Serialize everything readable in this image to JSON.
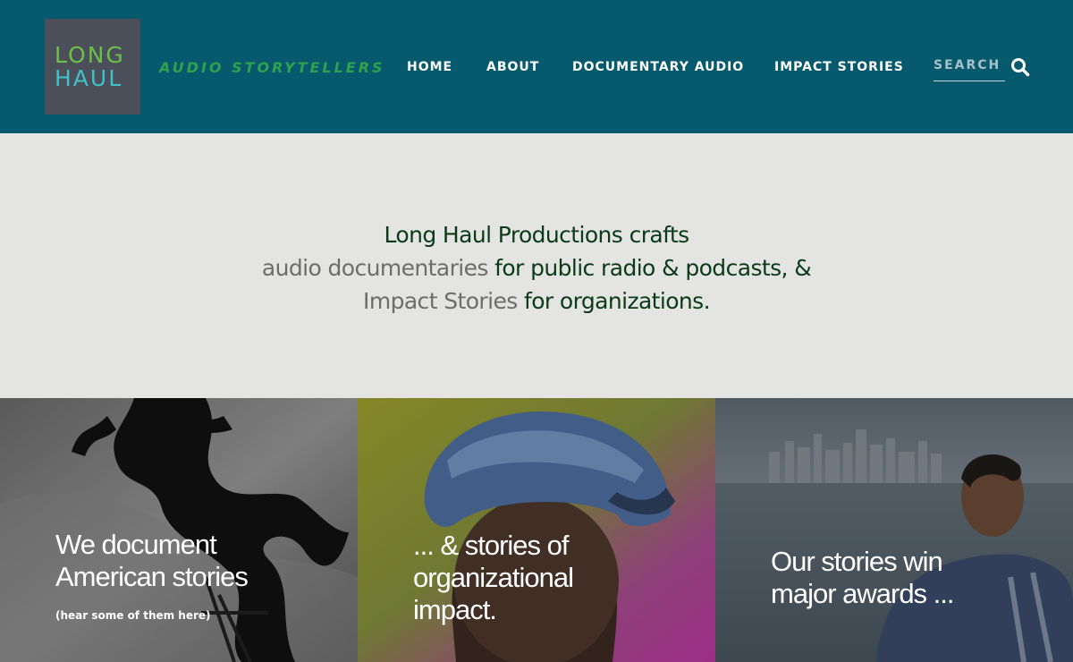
{
  "logo": {
    "line1": "LONG",
    "line2": "HAUL"
  },
  "header": {
    "tagline": "AUDIO STORYTELLERS"
  },
  "nav": {
    "items": [
      {
        "label": "HOME"
      },
      {
        "label": "ABOUT"
      },
      {
        "label": "DOCUMENTARY AUDIO"
      },
      {
        "label": "IMPACT STORIES"
      }
    ]
  },
  "search": {
    "placeholder": "SEARCH",
    "icon": "search-icon"
  },
  "intro": {
    "line1": "Long Haul Productions crafts",
    "line2_link": "audio documentaries",
    "line2_rest": " for public radio & podcasts, &",
    "line3_link": "Impact Stories",
    "line3_rest": " for organizations."
  },
  "tiles": [
    {
      "title_line1": "We document",
      "title_line2": "American stories",
      "subtitle": "(hear some of them here)"
    },
    {
      "title_line1": "... & stories of",
      "title_line2": "organizational",
      "title_line3": "impact."
    },
    {
      "title_line1": "Our stories win",
      "title_line2": "major awards ..."
    }
  ],
  "colors": {
    "header_bg": "#075a6d",
    "logo_bg": "#4b4f59",
    "logo_green": "#6cc04a",
    "logo_teal": "#3fc1c9",
    "tagline": "#2ea24d",
    "intro_bg": "#e4e5e3",
    "intro_text": "#0b3a17",
    "intro_link": "#6c6d6c"
  }
}
